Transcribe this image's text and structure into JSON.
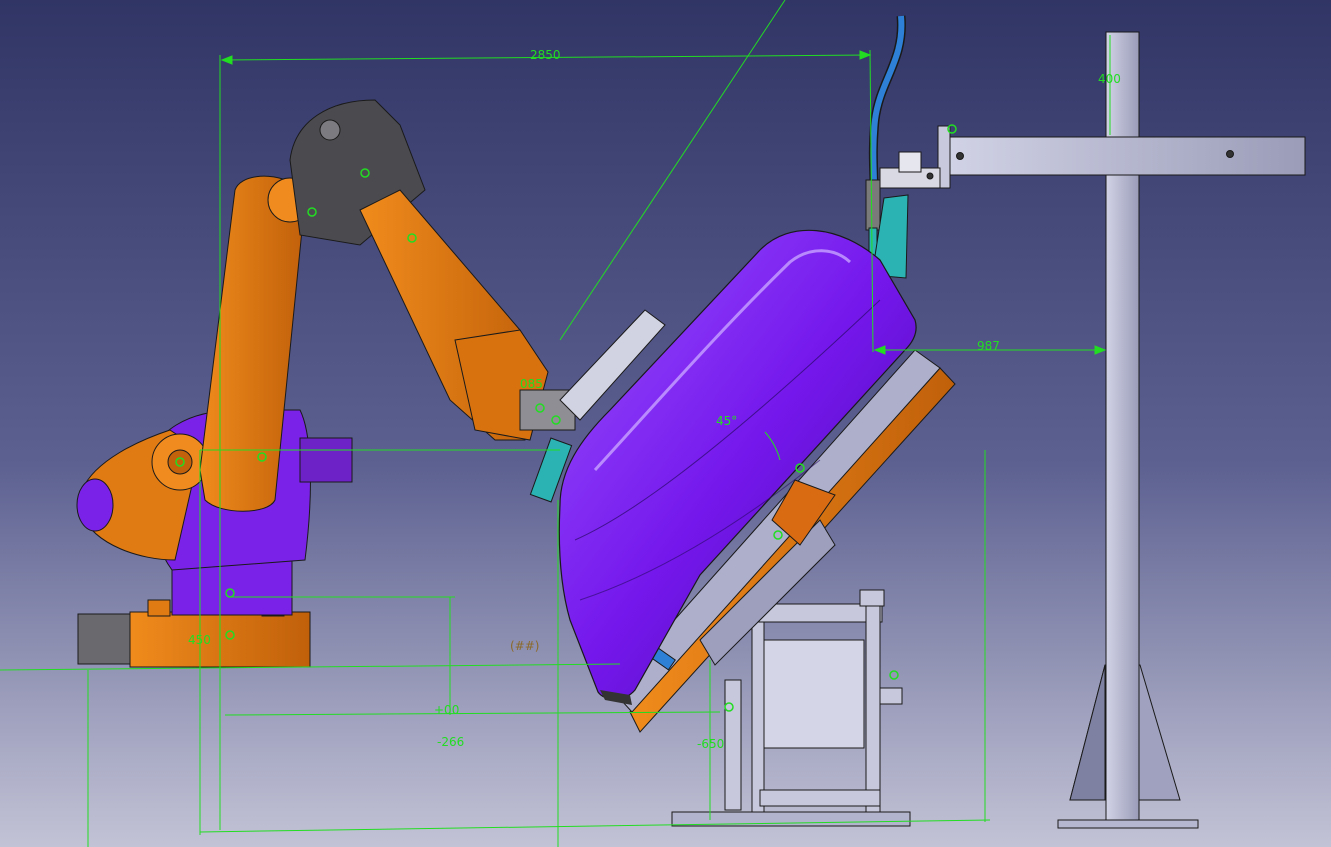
{
  "viewport": {
    "background_top": "#303566",
    "background_bottom": "#c3c3d6"
  },
  "colors": {
    "dimension": "#22dd22",
    "robot_orange": "#e07a12",
    "robot_orange_dark": "#a85006",
    "robot_purple": "#7a22e8",
    "robot_grey": "#4b4b4f",
    "part_purple": "#7b1fee",
    "fixture_orange": "#d96c12",
    "frame_grey": "#b9bbd4",
    "gun_blue": "#2e7fd6",
    "cyan": "#2bb3b3",
    "outline": "#1a1a1a"
  },
  "dimensions": {
    "top_width": "2850",
    "post_height": "400",
    "nozzle_to_post": "987",
    "tilt_angle": "45°",
    "base_left": "450",
    "base_offset": "+00",
    "base_drop": "-266",
    "stand_drop": "-650",
    "tcp_label": "085",
    "sketch_tag": "(##)"
  }
}
